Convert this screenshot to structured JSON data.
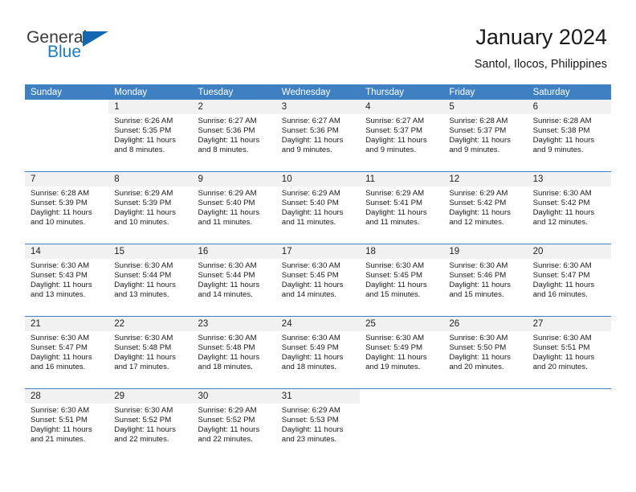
{
  "brand": {
    "name_top": "General",
    "name_bottom": "Blue",
    "triangle_color": "#1367b0",
    "blue_color": "#1b7bc4",
    "gray_color": "#3a3a3a"
  },
  "header": {
    "title": "January 2024",
    "subtitle": "Santol, Ilocos, Philippines"
  },
  "theme": {
    "header_bar_color": "#3f80c2",
    "day_number_bg": "#f1f1f1",
    "text_color": "#1a1a1a"
  },
  "weekdays": [
    "Sunday",
    "Monday",
    "Tuesday",
    "Wednesday",
    "Thursday",
    "Friday",
    "Saturday"
  ],
  "weeks": [
    [
      {
        "date": "",
        "sunrise": "",
        "sunset": "",
        "daylight": "",
        "empty": true
      },
      {
        "date": "1",
        "sunrise": "Sunrise: 6:26 AM",
        "sunset": "Sunset: 5:35 PM",
        "daylight": "Daylight: 11 hours and 8 minutes."
      },
      {
        "date": "2",
        "sunrise": "Sunrise: 6:27 AM",
        "sunset": "Sunset: 5:36 PM",
        "daylight": "Daylight: 11 hours and 8 minutes."
      },
      {
        "date": "3",
        "sunrise": "Sunrise: 6:27 AM",
        "sunset": "Sunset: 5:36 PM",
        "daylight": "Daylight: 11 hours and 9 minutes."
      },
      {
        "date": "4",
        "sunrise": "Sunrise: 6:27 AM",
        "sunset": "Sunset: 5:37 PM",
        "daylight": "Daylight: 11 hours and 9 minutes."
      },
      {
        "date": "5",
        "sunrise": "Sunrise: 6:28 AM",
        "sunset": "Sunset: 5:37 PM",
        "daylight": "Daylight: 11 hours and 9 minutes."
      },
      {
        "date": "6",
        "sunrise": "Sunrise: 6:28 AM",
        "sunset": "Sunset: 5:38 PM",
        "daylight": "Daylight: 11 hours and 9 minutes."
      }
    ],
    [
      {
        "date": "7",
        "sunrise": "Sunrise: 6:28 AM",
        "sunset": "Sunset: 5:39 PM",
        "daylight": "Daylight: 11 hours and 10 minutes."
      },
      {
        "date": "8",
        "sunrise": "Sunrise: 6:29 AM",
        "sunset": "Sunset: 5:39 PM",
        "daylight": "Daylight: 11 hours and 10 minutes."
      },
      {
        "date": "9",
        "sunrise": "Sunrise: 6:29 AM",
        "sunset": "Sunset: 5:40 PM",
        "daylight": "Daylight: 11 hours and 11 minutes."
      },
      {
        "date": "10",
        "sunrise": "Sunrise: 6:29 AM",
        "sunset": "Sunset: 5:40 PM",
        "daylight": "Daylight: 11 hours and 11 minutes."
      },
      {
        "date": "11",
        "sunrise": "Sunrise: 6:29 AM",
        "sunset": "Sunset: 5:41 PM",
        "daylight": "Daylight: 11 hours and 11 minutes."
      },
      {
        "date": "12",
        "sunrise": "Sunrise: 6:29 AM",
        "sunset": "Sunset: 5:42 PM",
        "daylight": "Daylight: 11 hours and 12 minutes."
      },
      {
        "date": "13",
        "sunrise": "Sunrise: 6:30 AM",
        "sunset": "Sunset: 5:42 PM",
        "daylight": "Daylight: 11 hours and 12 minutes."
      }
    ],
    [
      {
        "date": "14",
        "sunrise": "Sunrise: 6:30 AM",
        "sunset": "Sunset: 5:43 PM",
        "daylight": "Daylight: 11 hours and 13 minutes."
      },
      {
        "date": "15",
        "sunrise": "Sunrise: 6:30 AM",
        "sunset": "Sunset: 5:44 PM",
        "daylight": "Daylight: 11 hours and 13 minutes."
      },
      {
        "date": "16",
        "sunrise": "Sunrise: 6:30 AM",
        "sunset": "Sunset: 5:44 PM",
        "daylight": "Daylight: 11 hours and 14 minutes."
      },
      {
        "date": "17",
        "sunrise": "Sunrise: 6:30 AM",
        "sunset": "Sunset: 5:45 PM",
        "daylight": "Daylight: 11 hours and 14 minutes."
      },
      {
        "date": "18",
        "sunrise": "Sunrise: 6:30 AM",
        "sunset": "Sunset: 5:45 PM",
        "daylight": "Daylight: 11 hours and 15 minutes."
      },
      {
        "date": "19",
        "sunrise": "Sunrise: 6:30 AM",
        "sunset": "Sunset: 5:46 PM",
        "daylight": "Daylight: 11 hours and 15 minutes."
      },
      {
        "date": "20",
        "sunrise": "Sunrise: 6:30 AM",
        "sunset": "Sunset: 5:47 PM",
        "daylight": "Daylight: 11 hours and 16 minutes."
      }
    ],
    [
      {
        "date": "21",
        "sunrise": "Sunrise: 6:30 AM",
        "sunset": "Sunset: 5:47 PM",
        "daylight": "Daylight: 11 hours and 16 minutes."
      },
      {
        "date": "22",
        "sunrise": "Sunrise: 6:30 AM",
        "sunset": "Sunset: 5:48 PM",
        "daylight": "Daylight: 11 hours and 17 minutes."
      },
      {
        "date": "23",
        "sunrise": "Sunrise: 6:30 AM",
        "sunset": "Sunset: 5:48 PM",
        "daylight": "Daylight: 11 hours and 18 minutes."
      },
      {
        "date": "24",
        "sunrise": "Sunrise: 6:30 AM",
        "sunset": "Sunset: 5:49 PM",
        "daylight": "Daylight: 11 hours and 18 minutes."
      },
      {
        "date": "25",
        "sunrise": "Sunrise: 6:30 AM",
        "sunset": "Sunset: 5:49 PM",
        "daylight": "Daylight: 11 hours and 19 minutes."
      },
      {
        "date": "26",
        "sunrise": "Sunrise: 6:30 AM",
        "sunset": "Sunset: 5:50 PM",
        "daylight": "Daylight: 11 hours and 20 minutes."
      },
      {
        "date": "27",
        "sunrise": "Sunrise: 6:30 AM",
        "sunset": "Sunset: 5:51 PM",
        "daylight": "Daylight: 11 hours and 20 minutes."
      }
    ],
    [
      {
        "date": "28",
        "sunrise": "Sunrise: 6:30 AM",
        "sunset": "Sunset: 5:51 PM",
        "daylight": "Daylight: 11 hours and 21 minutes."
      },
      {
        "date": "29",
        "sunrise": "Sunrise: 6:30 AM",
        "sunset": "Sunset: 5:52 PM",
        "daylight": "Daylight: 11 hours and 22 minutes."
      },
      {
        "date": "30",
        "sunrise": "Sunrise: 6:29 AM",
        "sunset": "Sunset: 5:52 PM",
        "daylight": "Daylight: 11 hours and 22 minutes."
      },
      {
        "date": "31",
        "sunrise": "Sunrise: 6:29 AM",
        "sunset": "Sunset: 5:53 PM",
        "daylight": "Daylight: 11 hours and 23 minutes."
      },
      {
        "date": "",
        "sunrise": "",
        "sunset": "",
        "daylight": "",
        "empty": true
      },
      {
        "date": "",
        "sunrise": "",
        "sunset": "",
        "daylight": "",
        "empty": true
      },
      {
        "date": "",
        "sunrise": "",
        "sunset": "",
        "daylight": "",
        "empty": true
      }
    ]
  ]
}
